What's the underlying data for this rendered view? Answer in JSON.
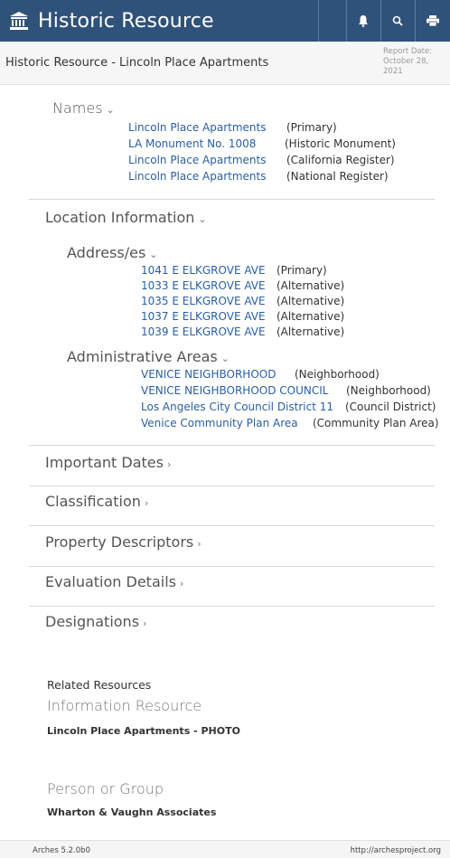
{
  "topbar": {
    "title": "Historic Resource"
  },
  "report": {
    "title": "Historic Resource - Lincoln Place Apartments",
    "date_label": "Report Date:",
    "date_value": "October 28, 2021"
  },
  "names": {
    "heading": "Names",
    "rows": [
      {
        "value": "Lincoln Place Apartments",
        "type": "(Primary)"
      },
      {
        "value": "LA Monument No. 1008",
        "type": "(Historic Monument)"
      },
      {
        "value": "Lincoln Place Apartments",
        "type": "(California Register)"
      },
      {
        "value": "Lincoln Place Apartments",
        "type": "(National Register)"
      }
    ]
  },
  "location": {
    "heading": "Location Information",
    "addresses": {
      "heading": "Address/es",
      "rows": [
        {
          "value": "1041 E ELKGROVE AVE",
          "type": "(Primary)"
        },
        {
          "value": "1033 E ELKGROVE AVE",
          "type": "(Alternative)"
        },
        {
          "value": "1035 E ELKGROVE AVE",
          "type": "(Alternative)"
        },
        {
          "value": "1037 E ELKGROVE AVE",
          "type": "(Alternative)"
        },
        {
          "value": "1039 E ELKGROVE AVE",
          "type": "(Alternative)"
        }
      ]
    },
    "admin": {
      "heading": "Administrative Areas",
      "rows": [
        {
          "value": "VENICE NEIGHBORHOOD",
          "type": "(Neighborhood)"
        },
        {
          "value": "VENICE NEIGHBORHOOD COUNCIL",
          "type": "(Neighborhood)"
        },
        {
          "value": "Los Angeles City Council District 11",
          "type": "(Council District)"
        },
        {
          "value": "Venice Community Plan Area",
          "type": "(Community Plan Area)"
        }
      ]
    }
  },
  "sections": [
    {
      "label": "Important Dates"
    },
    {
      "label": "Classification"
    },
    {
      "label": "Property Descriptors"
    },
    {
      "label": "Evaluation Details"
    },
    {
      "label": "Designations"
    }
  ],
  "related": {
    "label": "Related Resources",
    "groups": [
      {
        "type": "Information Resource",
        "item": "Lincoln Place Apartments - PHOTO"
      },
      {
        "type": "Person or Group",
        "item": "Wharton & Vaughn Associates"
      }
    ]
  },
  "footer": {
    "version": "Arches 5.2.0b0",
    "url": "http://archesproject.org"
  },
  "colors": {
    "topbar": "#2f527a",
    "link": "#2a5fa6"
  }
}
